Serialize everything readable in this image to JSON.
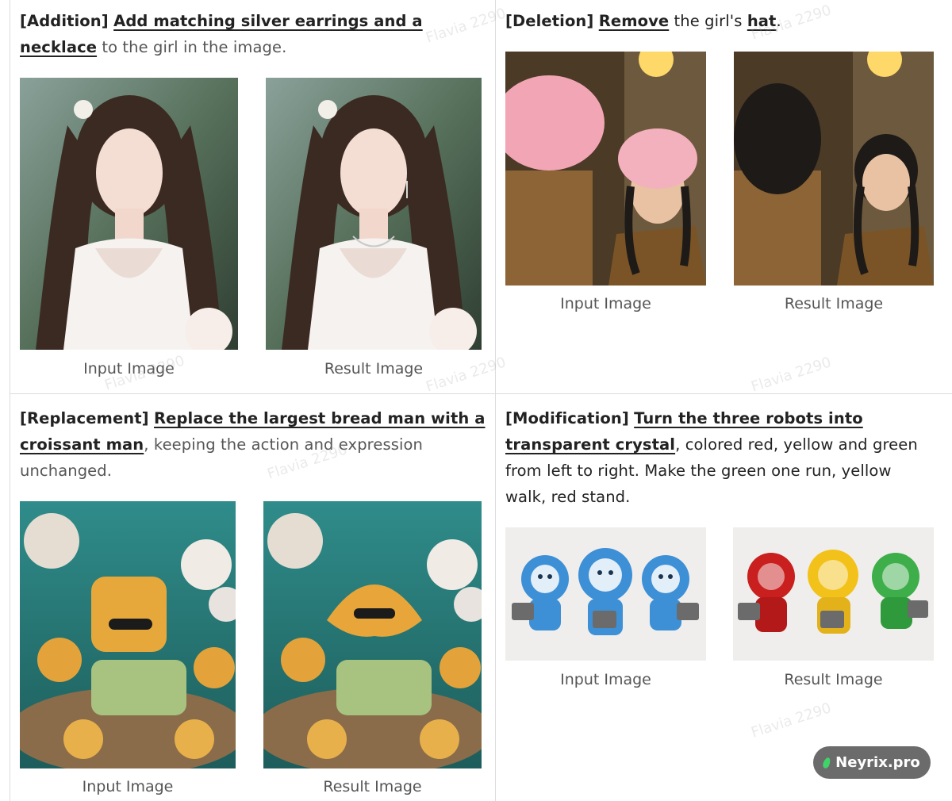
{
  "cells": {
    "addition": {
      "tag": "[Addition]",
      "instruction": "Add matching silver earrings and a necklace",
      "rest": " to the girl in the image.",
      "input_caption": "Input Image",
      "result_caption": "Result Image"
    },
    "deletion": {
      "tag": "[Deletion]",
      "verb": "Remove",
      "mid": " the girl's ",
      "obj": "hat",
      "end": ".",
      "input_caption": "Input Image",
      "result_caption": "Result Image"
    },
    "replacement": {
      "tag": "[Replacement]",
      "instruction_1": "Replace the largest bread man with a",
      "instruction_2": "croissant man",
      "rest": ", keeping the action and expression unchanged.",
      "input_caption": "Input Image",
      "result_caption": "Result Image"
    },
    "modification": {
      "tag": "[Modification]",
      "instruction_1": "Turn the three robots into",
      "instruction_2": "transparent crystal",
      "rest": ", colored red, yellow and green from left to right. Make the green one run, yellow walk, red stand.",
      "input_caption": "Input Image",
      "result_caption": "Result Image"
    }
  },
  "watermark": "Flavia 2290",
  "badge": {
    "label": "Neyrix.pro",
    "icon": "leaf-icon"
  },
  "colors": {
    "accent_green": "#3fd46a",
    "badge_bg": "#6b6b6b",
    "grid_line": "#dcdcdc"
  }
}
